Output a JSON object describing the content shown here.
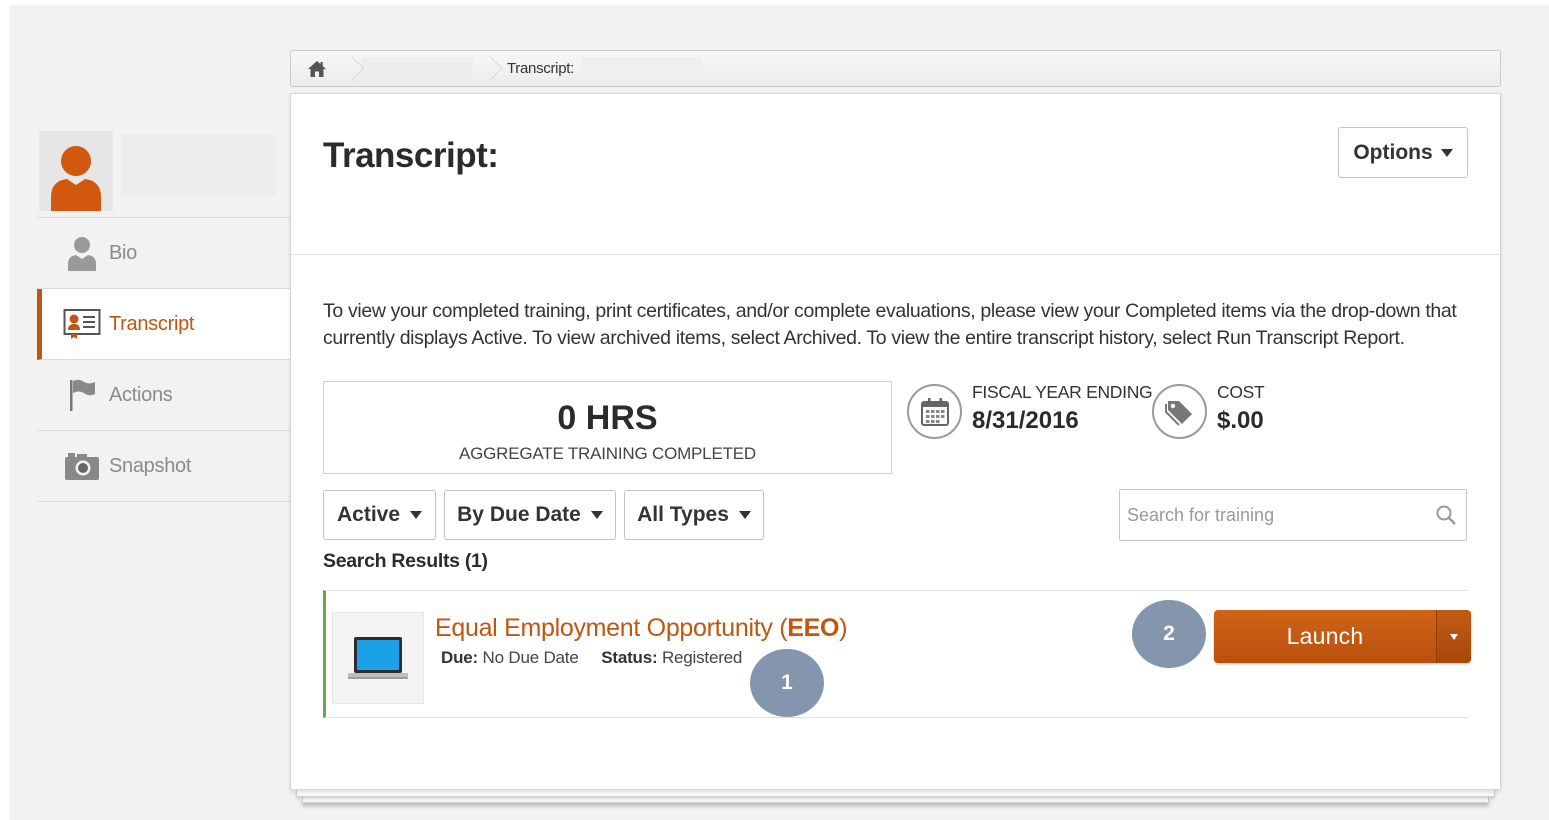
{
  "breadcrumb": {
    "current": "Transcript:"
  },
  "sidebar": {
    "items": [
      {
        "label": "Bio",
        "icon": "person-icon",
        "active": false
      },
      {
        "label": "Transcript",
        "icon": "transcript-icon",
        "active": true
      },
      {
        "label": "Actions",
        "icon": "flag-icon",
        "active": false
      },
      {
        "label": "Snapshot",
        "icon": "camera-icon",
        "active": false
      }
    ]
  },
  "header": {
    "title": "Transcript:",
    "options_label": "Options"
  },
  "intro_text": "To view your completed training, print certificates, and/or complete evaluations, please view your Completed items via the drop-down that currently displays Active. To view archived items, select Archived. To view the entire transcript history, select Run Transcript Report.",
  "stats": {
    "hours_value": "0 HRS",
    "hours_label": "AGGREGATE TRAINING COMPLETED",
    "fiscal_label": "FISCAL YEAR ENDING",
    "fiscal_value": "8/31/2016",
    "cost_label": "COST",
    "cost_value": "$.00"
  },
  "filters": {
    "status": "Active",
    "sort": "By Due Date",
    "type": "All Types"
  },
  "search": {
    "placeholder": "Search for training"
  },
  "results": {
    "count_label": "Search Results (1)",
    "items": [
      {
        "title_main": "Equal Employment Opportunity (",
        "title_abbr": "EEO",
        "title_end": ")",
        "due_label": "Due:",
        "due_value": "No Due Date",
        "status_label": "Status:",
        "status_value": "Registered",
        "action_label": "Launch"
      }
    ]
  },
  "markers": [
    "1",
    "2"
  ],
  "colors": {
    "accent": "#c0560f",
    "launch": "#c55a12",
    "marker": "#8496ae",
    "row_border": "#6aa84f"
  }
}
